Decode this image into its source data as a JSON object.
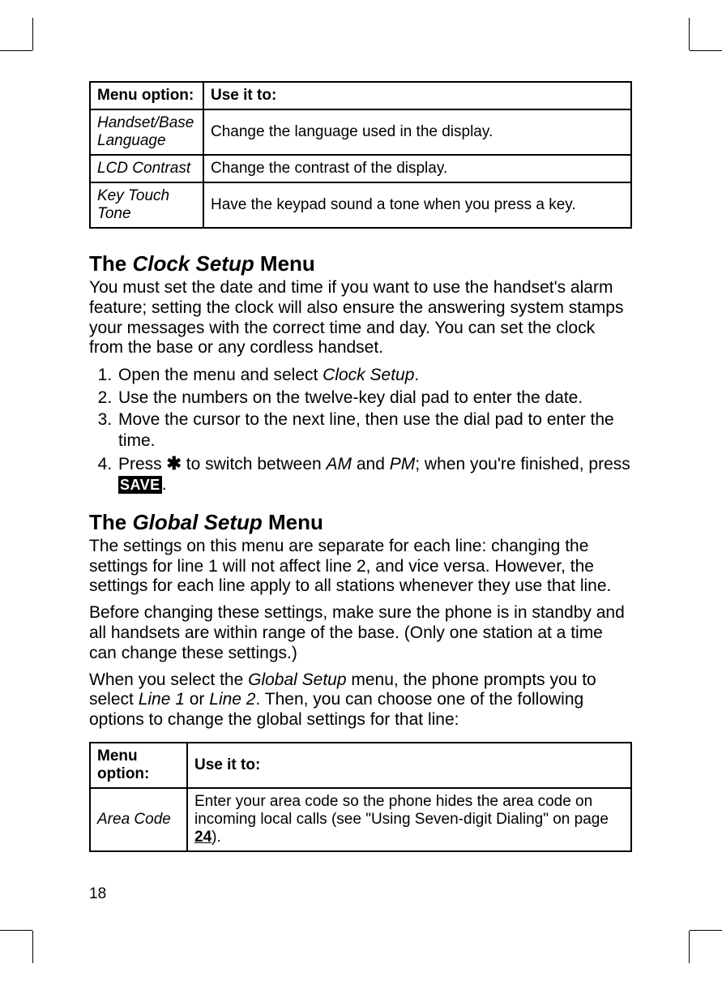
{
  "page_number": "18",
  "table1": {
    "header": {
      "col1": "Menu option:",
      "col2": "Use it to:"
    },
    "rows": [
      {
        "option": "Handset/Base Language",
        "desc": "Change the language used in the display."
      },
      {
        "option": "LCD Contrast",
        "desc": "Change the contrast of the display."
      },
      {
        "option": "Key Touch Tone",
        "desc": "Have the keypad sound a tone when you press a key."
      }
    ]
  },
  "clock_section": {
    "heading_prefix": "The ",
    "heading_italic": "Clock Setup",
    "heading_suffix": " Menu",
    "paragraph": "You must set the date and time if you want to use the handset's alarm feature; setting the clock will also ensure the answering system stamps your messages with the correct time and day. You can set the clock from the base or any cordless handset.",
    "steps": {
      "s1_a": "Open the menu and select ",
      "s1_b": "Clock Setup",
      "s1_c": ".",
      "s2": "Use the numbers on the twelve-key dial pad to enter the date.",
      "s3": "Move the cursor to the next line, then use the dial pad to enter the time.",
      "s4_a": "Press ",
      "s4_star": "✱",
      "s4_b": " to switch between ",
      "s4_am": "AM",
      "s4_c": " and ",
      "s4_pm": "PM",
      "s4_d": "; when you're finished, press ",
      "s4_save": "SAVE",
      "s4_e": "."
    }
  },
  "global_section": {
    "heading_prefix": "The ",
    "heading_italic": "Global Setup",
    "heading_suffix": " Menu",
    "p1": "The settings on this menu are separate for each line: changing the settings for line 1 will not affect line 2, and vice versa. However, the settings for each line apply to all stations whenever they use that line.",
    "p2": "Before changing these settings, make sure the phone is in standby and all handsets are within range of the base. (Only one station at a time can change these settings.)",
    "p3_a": "When you select the ",
    "p3_b": "Global Setup",
    "p3_c": " menu, the phone prompts you to select ",
    "p3_d": "Line 1",
    "p3_e": " or ",
    "p3_f": "Line 2",
    "p3_g": ". Then, you can choose one of the following options to change the global settings for that line:"
  },
  "table2": {
    "header": {
      "col1": "Menu option:",
      "col2": "Use it to:"
    },
    "row1": {
      "option": "Area Code",
      "desc_a": "Enter your area code so the phone hides the area code on incoming local calls (see \"Using Seven-digit Dialing\" on page ",
      "page_ref": "24",
      "desc_b": ")."
    }
  }
}
